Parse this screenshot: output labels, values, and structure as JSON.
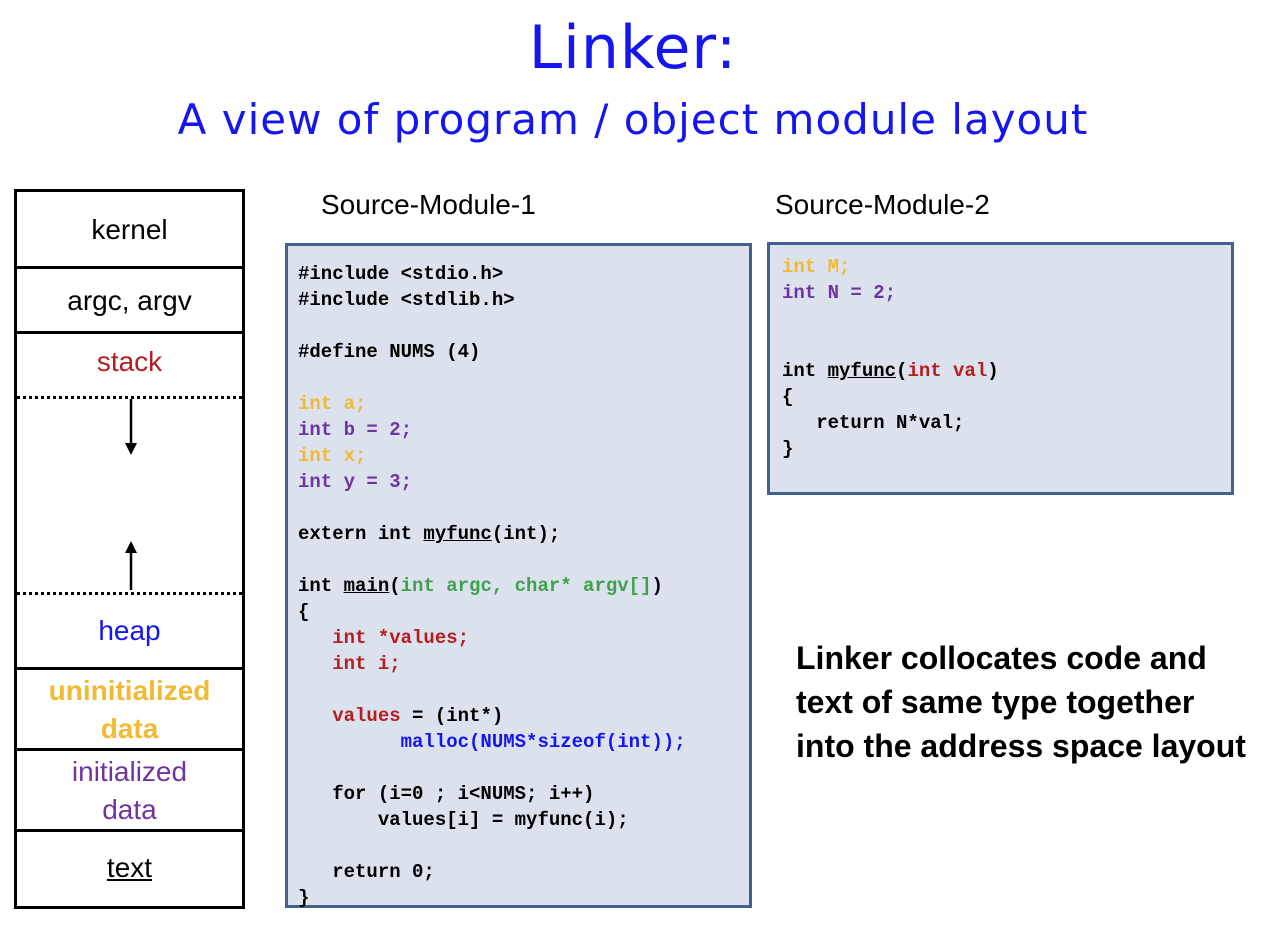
{
  "title": "Linker:",
  "subtitle": "A view of program / object module layout",
  "memory_layout": {
    "kernel": "kernel",
    "args": "argc, argv",
    "stack": "stack",
    "heap": "heap",
    "uninit_line1": "uninitialized",
    "uninit_line2": "data",
    "init_line1": "initialized",
    "init_line2": "data",
    "text": "text"
  },
  "module1": {
    "label": "Source-Module-1",
    "lines": {
      "inc1": "#include <stdio.h>",
      "inc2": "#include <stdlib.h>",
      "define": "#define NUMS (4)",
      "int_a": "int a;",
      "int_b": "int b = 2;",
      "int_x": "int x;",
      "int_y": "int y = 3;",
      "extern_kw": "extern int ",
      "extern_fn": "myfunc",
      "extern_rest": "(int);",
      "main_kw": "int ",
      "main_fn": "main",
      "main_open": "(",
      "main_params": "int argc, char* argv[]",
      "main_close": ")",
      "brace_open": "{",
      "decl_values": "   int *values;",
      "decl_i": "   int i;",
      "assign_var": "   values",
      "assign_rest": " = (int*)",
      "malloc": "         malloc(NUMS*sizeof(int));",
      "for": "   for (i=0 ; i<NUMS; i++)",
      "call": "       values[i] = myfunc(i);",
      "ret": "   return 0;",
      "brace_close": "}"
    }
  },
  "module2": {
    "label": "Source-Module-2",
    "lines": {
      "int_m": "int M;",
      "int_n": "int N = 2;",
      "fn_kw": "int ",
      "fn_name": "myfunc",
      "fn_open": "(",
      "fn_param": "int val",
      "fn_close": ")",
      "brace_open": "{",
      "ret": "   return N*val;",
      "brace_close": "}"
    }
  },
  "note": "Linker collocates code and text of same type together into the address space layout",
  "colors": {
    "title": "#1515f0",
    "uninitialized": "#f0ba35",
    "initialized": "#6e35a0",
    "stack": "#b51e1e",
    "heap": "#1515f0",
    "params": "#3fa24a",
    "code_bg": "#dbe2ed",
    "code_border": "#44608e"
  }
}
